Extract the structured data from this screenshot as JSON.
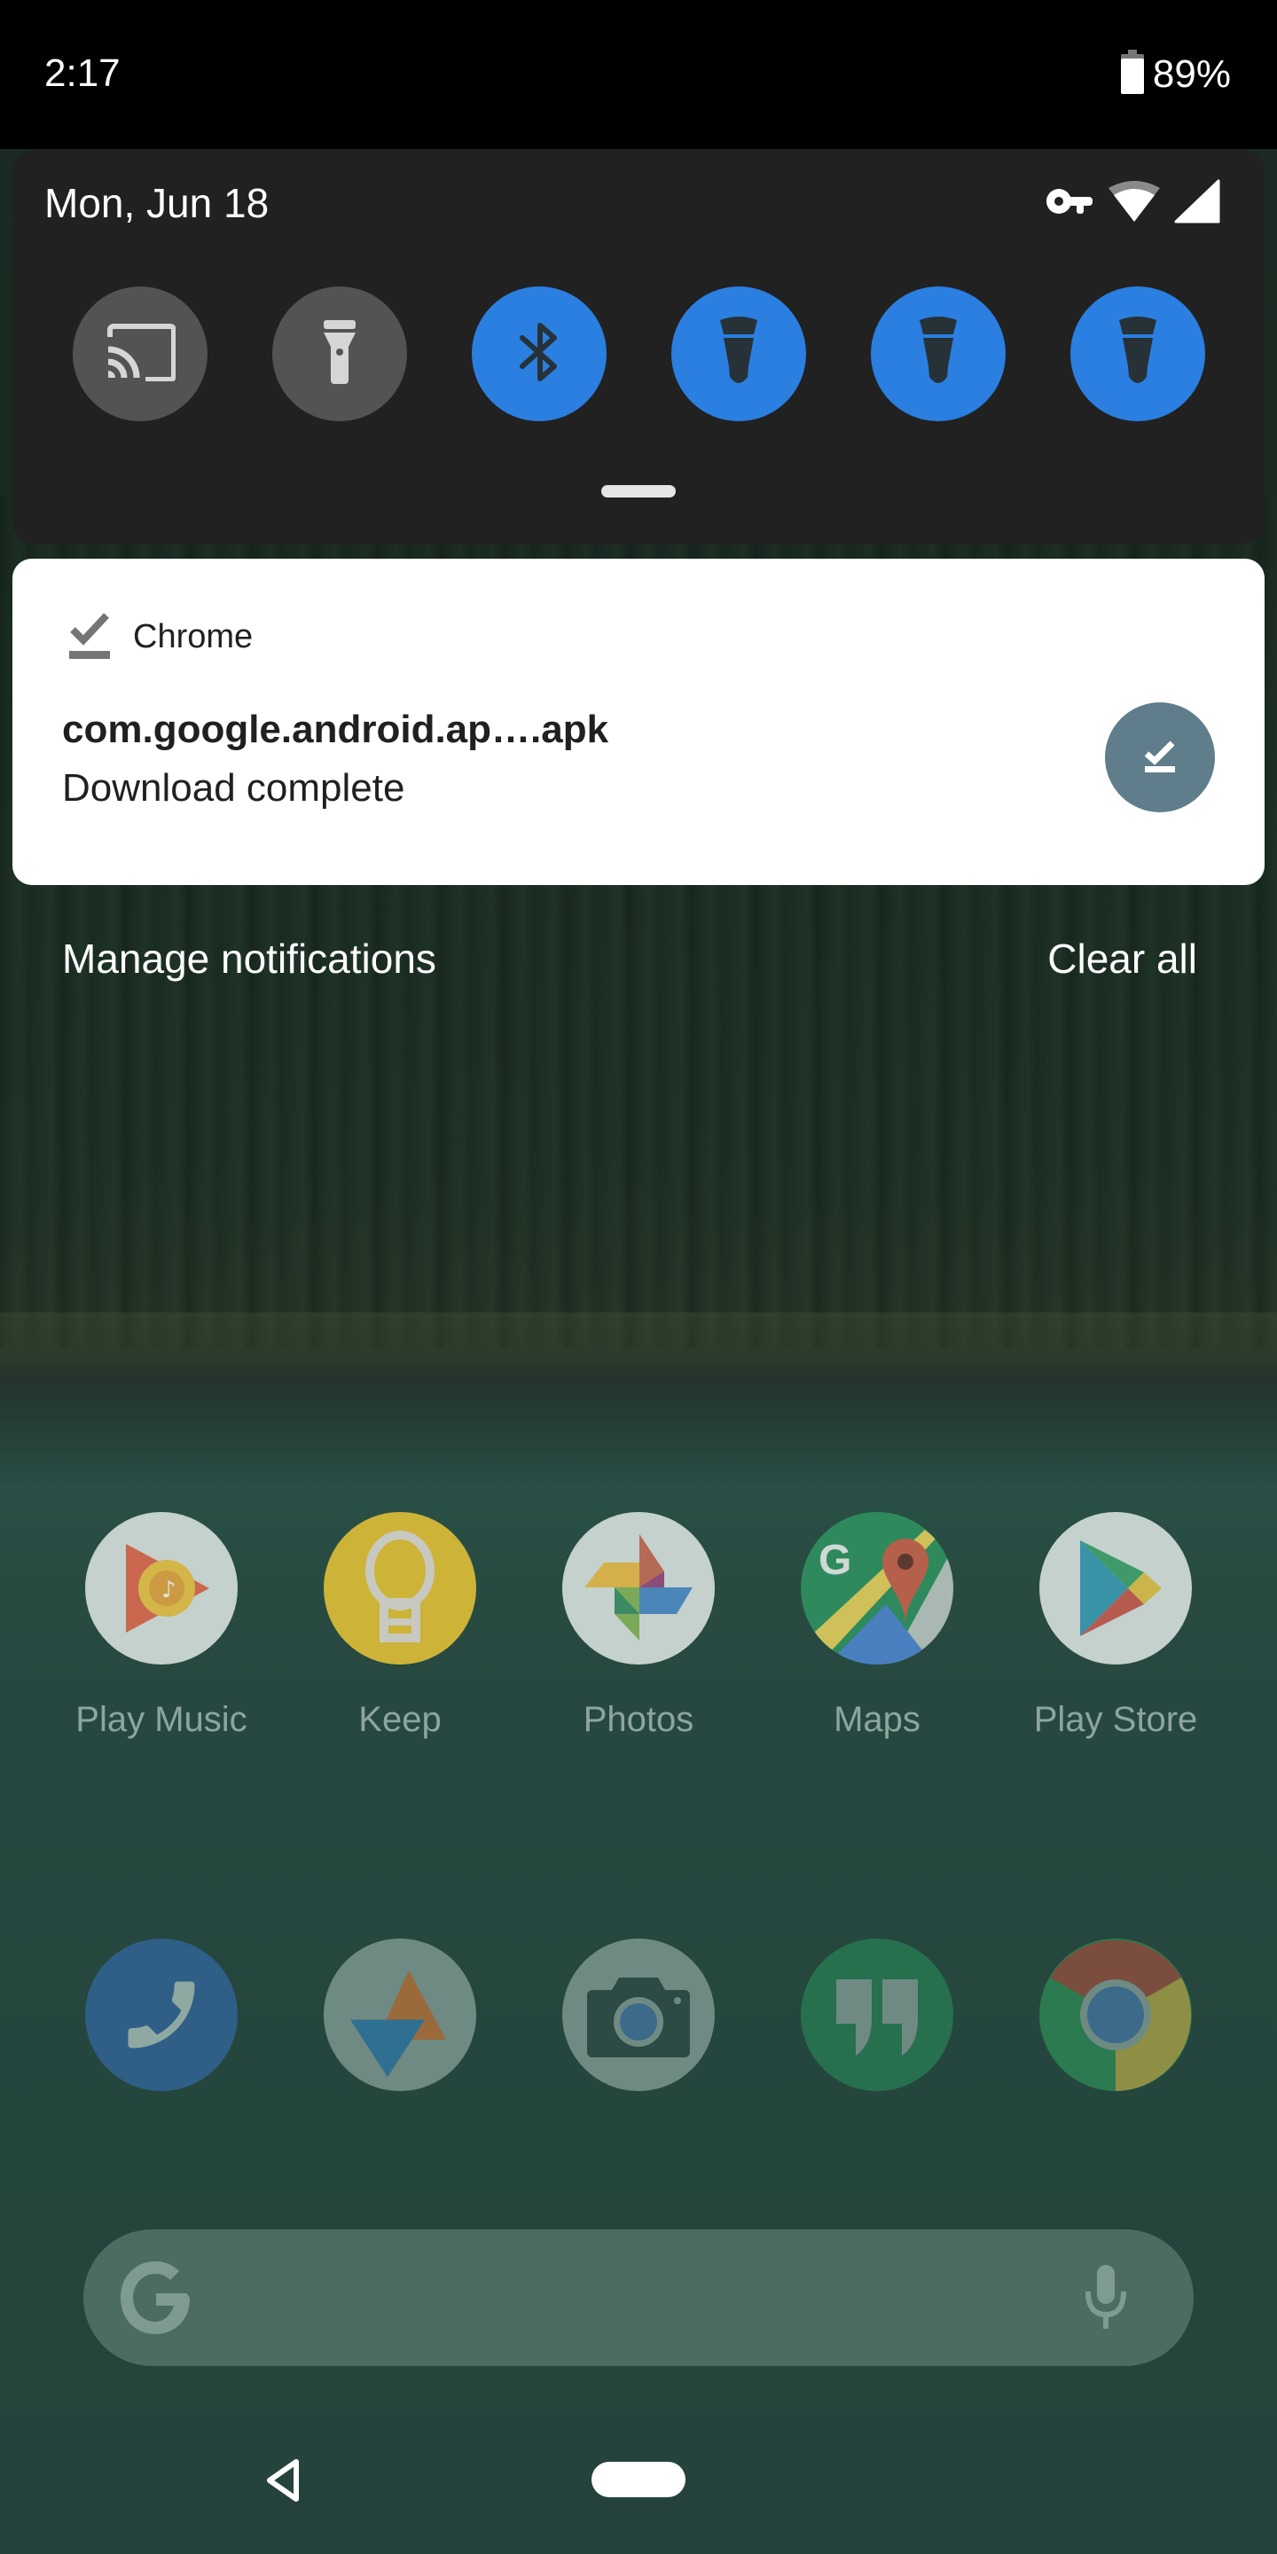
{
  "status_bar": {
    "time": "2:17",
    "battery_percent": "89%",
    "battery_level": 0.89,
    "icons": [
      "battery-icon"
    ]
  },
  "quick_settings": {
    "date": "Mon, Jun 18",
    "status_icons": [
      "vpn-key-icon",
      "wifi-icon",
      "cellular-signal-icon"
    ],
    "tiles": [
      {
        "name": "cast",
        "icon": "cast-icon",
        "state": "off"
      },
      {
        "name": "flashlight",
        "icon": "flashlight-icon",
        "state": "off"
      },
      {
        "name": "bluetooth",
        "icon": "bluetooth-icon",
        "state": "on"
      },
      {
        "name": "light-1",
        "icon": "light-bulb-icon",
        "state": "on"
      },
      {
        "name": "light-2",
        "icon": "light-bulb-icon",
        "state": "on"
      },
      {
        "name": "light-3",
        "icon": "light-bulb-icon",
        "state": "on"
      }
    ],
    "colors": {
      "tile_on": "#2a7fe0",
      "tile_off": "#535353",
      "panel": "#212121"
    }
  },
  "notification": {
    "app_name": "Chrome",
    "app_icon": "download-done-icon",
    "title": "com.google.android.ap….apk",
    "text": "Download complete",
    "action_icon": "download-done-icon",
    "action_color": "#607d8b"
  },
  "shade_footer": {
    "manage_label": "Manage notifications",
    "clear_label": "Clear all"
  },
  "home": {
    "apps_row": [
      {
        "label": "Play Music",
        "icon": "play-music-icon"
      },
      {
        "label": "Keep",
        "icon": "keep-icon"
      },
      {
        "label": "Photos",
        "icon": "photos-icon"
      },
      {
        "label": "Maps",
        "icon": "maps-icon"
      },
      {
        "label": "Play Store",
        "icon": "play-store-icon"
      }
    ],
    "dock": [
      {
        "name": "Phone",
        "icon": "phone-icon"
      },
      {
        "name": "Google Play Games / Stadia-like app",
        "icon": "triangle-app-icon"
      },
      {
        "name": "Camera",
        "icon": "camera-icon"
      },
      {
        "name": "Hangouts",
        "icon": "hangouts-icon"
      },
      {
        "name": "Chrome",
        "icon": "chrome-icon"
      }
    ],
    "search": {
      "logo": "G",
      "mic": "mic-icon"
    }
  },
  "nav_bar": {
    "back": "back-icon",
    "home": "home-pill"
  }
}
